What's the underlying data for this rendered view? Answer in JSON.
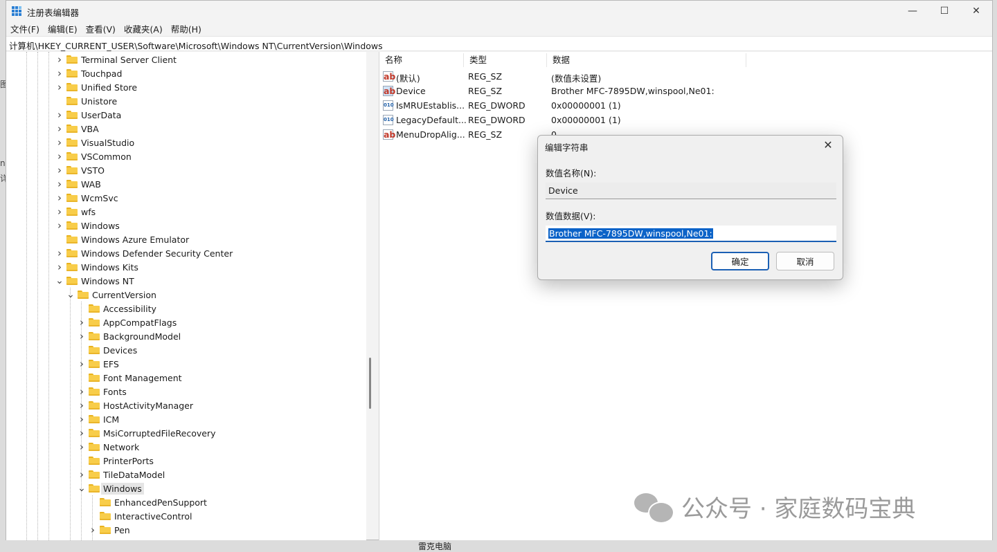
{
  "window": {
    "title": "注册表编辑器",
    "minimize": "—",
    "maximize": "☐",
    "close": "✕"
  },
  "menu": [
    "文件(F)",
    "编辑(E)",
    "查看(V)",
    "收藏夹(A)",
    "帮助(H)"
  ],
  "address": "计算机\\HKEY_CURRENT_USER\\Software\\Microsoft\\Windows NT\\CurrentVersion\\Windows",
  "tree": [
    {
      "label": "Terminal Server Client",
      "expander": ">"
    },
    {
      "label": "Touchpad",
      "expander": ">"
    },
    {
      "label": "Unified Store",
      "expander": ">"
    },
    {
      "label": "Unistore",
      "expander": ""
    },
    {
      "label": "UserData",
      "expander": ">"
    },
    {
      "label": "VBA",
      "expander": ">"
    },
    {
      "label": "VisualStudio",
      "expander": ">"
    },
    {
      "label": "VSCommon",
      "expander": ">"
    },
    {
      "label": "VSTO",
      "expander": ">"
    },
    {
      "label": "WAB",
      "expander": ">"
    },
    {
      "label": "WcmSvc",
      "expander": ">"
    },
    {
      "label": "wfs",
      "expander": ">"
    },
    {
      "label": "Windows",
      "expander": ">"
    },
    {
      "label": "Windows Azure Emulator",
      "expander": ""
    },
    {
      "label": "Windows Defender Security Center",
      "expander": ">"
    },
    {
      "label": "Windows Kits",
      "expander": ">"
    },
    {
      "label": "Windows NT",
      "expander": "v"
    },
    {
      "label": "CurrentVersion",
      "expander": "v"
    },
    {
      "label": "Accessibility",
      "expander": ""
    },
    {
      "label": "AppCompatFlags",
      "expander": ">"
    },
    {
      "label": "BackgroundModel",
      "expander": ">"
    },
    {
      "label": "Devices",
      "expander": ""
    },
    {
      "label": "EFS",
      "expander": ">"
    },
    {
      "label": "Font Management",
      "expander": ""
    },
    {
      "label": "Fonts",
      "expander": ">"
    },
    {
      "label": "HostActivityManager",
      "expander": ">"
    },
    {
      "label": "ICM",
      "expander": ">"
    },
    {
      "label": "MsiCorruptedFileRecovery",
      "expander": ">"
    },
    {
      "label": "Network",
      "expander": ">"
    },
    {
      "label": "PrinterPorts",
      "expander": ""
    },
    {
      "label": "TileDataModel",
      "expander": ">"
    },
    {
      "label": "Windows",
      "expander": "v"
    },
    {
      "label": "EnhancedPenSupport",
      "expander": ""
    },
    {
      "label": "InteractiveControl",
      "expander": ""
    },
    {
      "label": "Pen",
      "expander": ">"
    }
  ],
  "columns": {
    "name": "名称",
    "type": "类型",
    "data": "数据"
  },
  "values": [
    {
      "name": "(默认)",
      "type": "REG_SZ",
      "data": "(数值未设置)",
      "icon": "string-value-icon"
    },
    {
      "name": "Device",
      "type": "REG_SZ",
      "data": "Brother MFC-7895DW,winspool,Ne01:",
      "icon": "string-value-icon"
    },
    {
      "name": "IsMRUEstablis...",
      "type": "REG_DWORD",
      "data": "0x00000001 (1)",
      "icon": "dword-value-icon"
    },
    {
      "name": "LegacyDefault...",
      "type": "REG_DWORD",
      "data": "0x00000001 (1)",
      "icon": "dword-value-icon"
    },
    {
      "name": "MenuDropAlig...",
      "type": "REG_SZ",
      "data": "0",
      "icon": "string-value-icon"
    }
  ],
  "dialog": {
    "title": "编辑字符串",
    "close": "✕",
    "name_label": "数值名称(N):",
    "name_value": "Device",
    "data_label": "数值数据(V):",
    "data_value": "Brother MFC-7895DW,winspool,Ne01:",
    "ok": "确定",
    "cancel": "取消"
  },
  "watermark": "公众号 · 家庭数码宝典",
  "background_fragments": {
    "left1": "图",
    "left2": "nc",
    "left3": "详",
    "bottom": "雷克电脑"
  }
}
